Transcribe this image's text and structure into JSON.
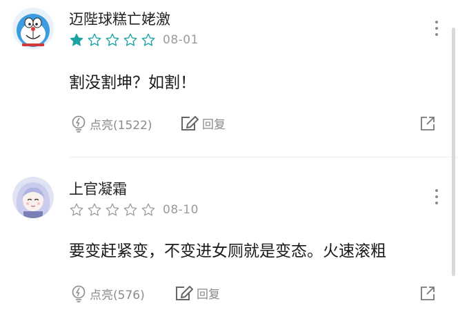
{
  "comments": [
    {
      "username": "迈陛球糕亡姥激",
      "date": "08-01",
      "stars_filled": 1,
      "stars_total": 5,
      "content": "割没割坤？如割！",
      "like_label": "点亮(1522)",
      "reply_label": "回复",
      "avatar": "doraemon-avatar"
    },
    {
      "username": "上官凝霜",
      "date": "08-10",
      "stars_filled": 0,
      "stars_total": 5,
      "content": "要变赶紧变，不变进女厕就是变态。火速滚粗",
      "like_label": "点亮(576)",
      "reply_label": "回复",
      "avatar": "anime-girl-avatar"
    }
  ],
  "colors": {
    "accent": "#1aa3a3",
    "muted": "#8a8a8a",
    "star_empty": "#9a9a9a"
  },
  "icons": [
    "more-icon",
    "lightbulb-icon",
    "edit-icon",
    "share-icon",
    "star-icon"
  ]
}
